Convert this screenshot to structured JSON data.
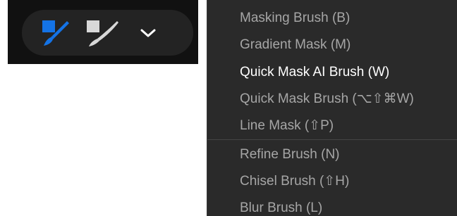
{
  "toolbar": {
    "icons": [
      {
        "name": "masking-brush-icon",
        "color": "#1473e6",
        "state": "selected"
      },
      {
        "name": "quick-mask-brush-icon",
        "color": "#d8d8d8"
      },
      {
        "name": "chevron-down-icon",
        "color": "#ffffff"
      }
    ]
  },
  "menu": {
    "section1": [
      {
        "label": "Masking Brush (B)"
      },
      {
        "label": "Gradient Mask (M)"
      },
      {
        "label": "Quick Mask AI Brush (W)",
        "active": true
      },
      {
        "label": "Quick Mask Brush (⌥⇧⌘W)"
      },
      {
        "label": "Line Mask (⇧P)"
      }
    ],
    "section2": [
      {
        "label": "Refine Brush (N)"
      },
      {
        "label": "Chisel Brush (⇧H)"
      },
      {
        "label": "Blur Brush (L)"
      }
    ]
  },
  "colors": {
    "accent": "#1473e6",
    "menu_bg": "#2a2a2a",
    "menu_text": "#a6a6a6",
    "menu_text_active": "#ffffff"
  }
}
